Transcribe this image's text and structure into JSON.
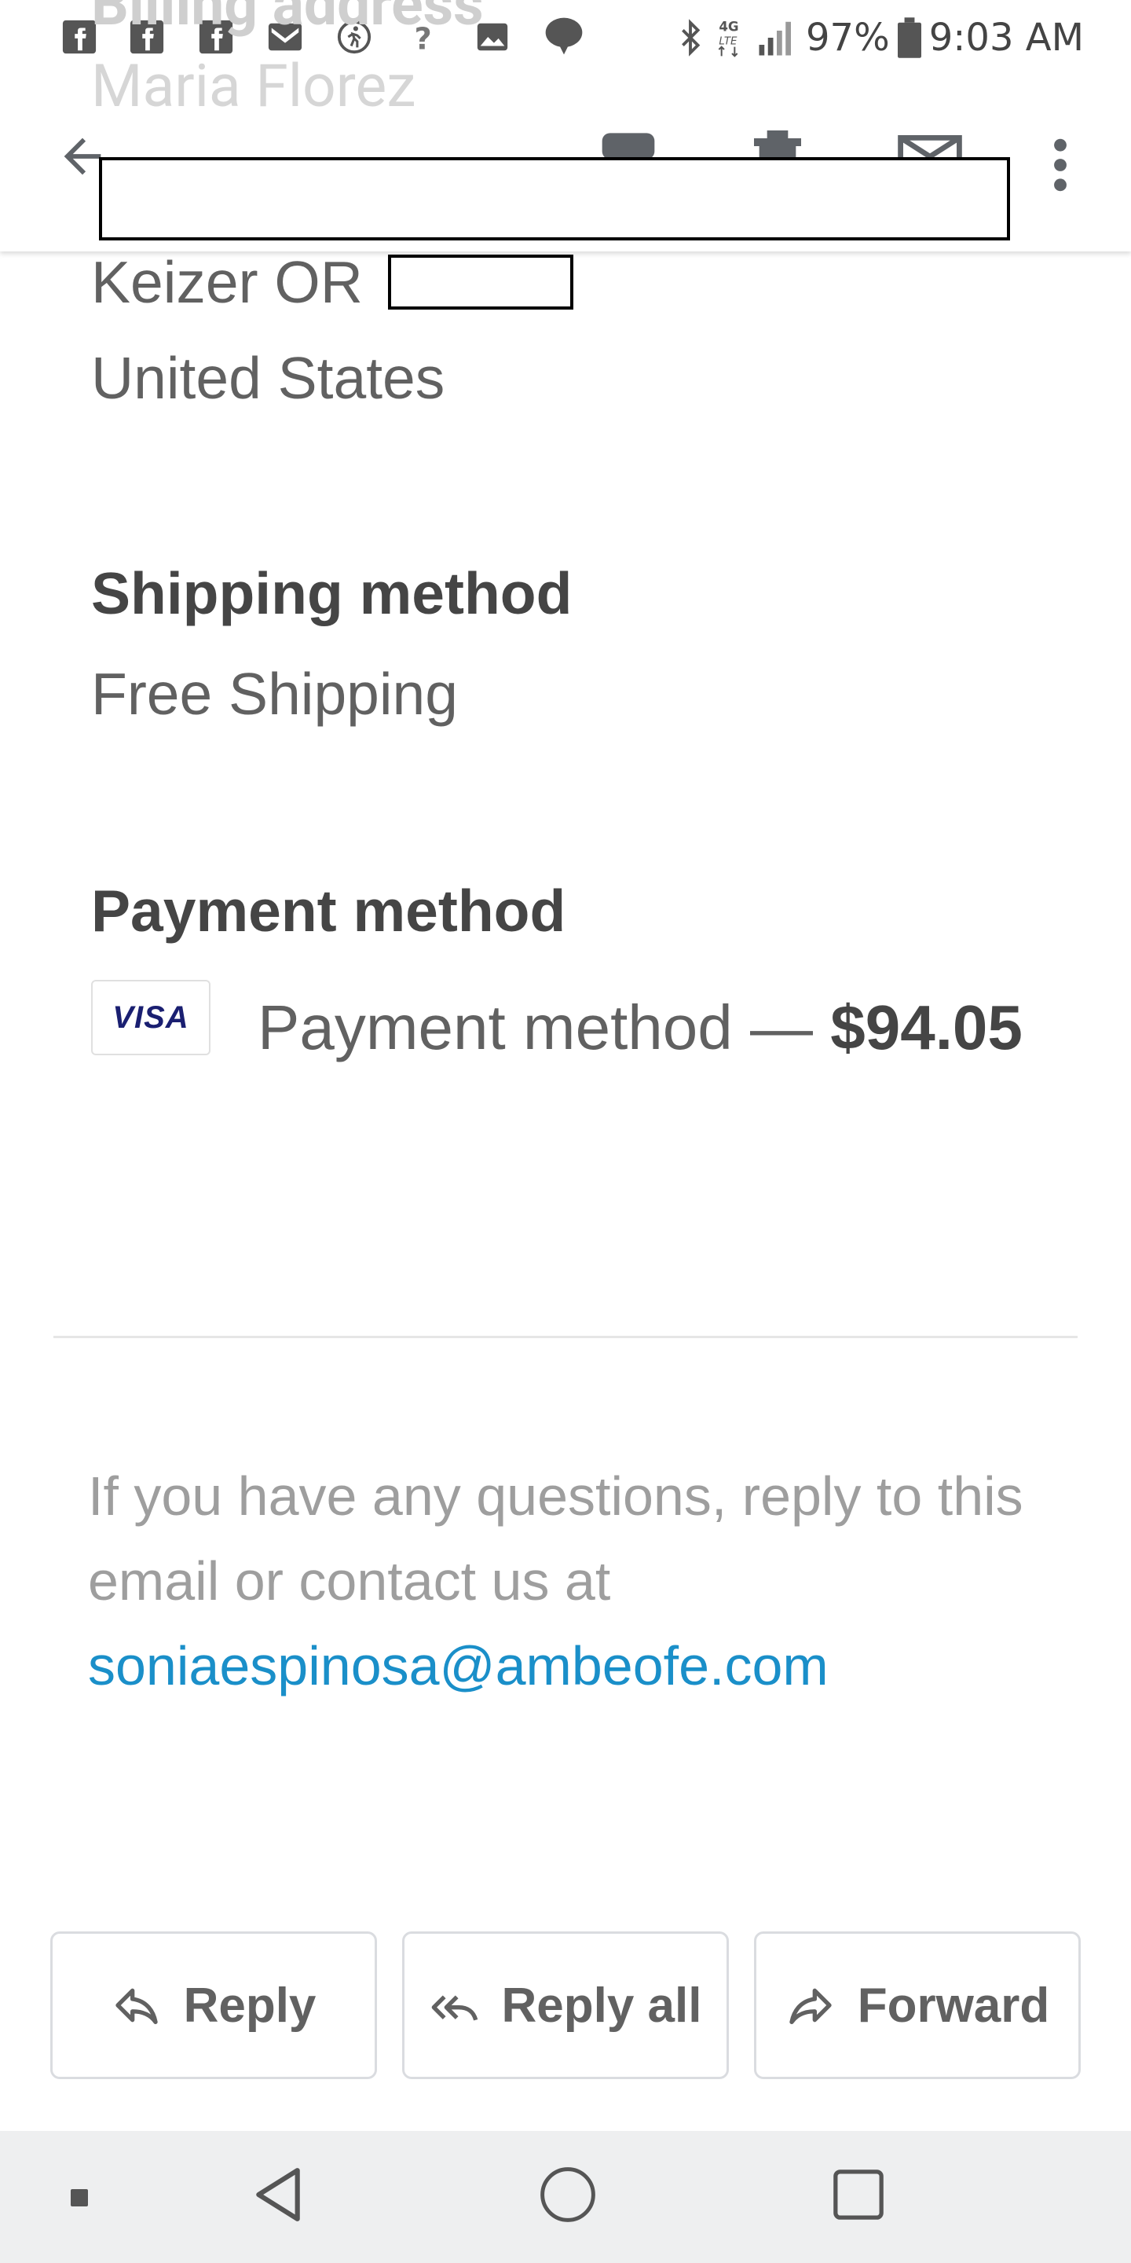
{
  "status_bar": {
    "icons": [
      "facebook-icon",
      "facebook-icon",
      "facebook-icon",
      "gmail-icon",
      "activity-icon",
      "question-icon",
      "image-icon",
      "notification-icon",
      "bluetooth-icon",
      "lte-icon",
      "signal-icon",
      "battery-icon"
    ],
    "network": "4G LTE",
    "battery": "97%",
    "time": "9:03 AM"
  },
  "scrolled_under": {
    "section_heading": "Billing address",
    "name": "Maria Florez"
  },
  "toolbar": {
    "back_icon": "arrow-back-icon",
    "archive_icon": "archive-icon",
    "delete_icon": "delete-icon",
    "mark_unread_icon": "mail-icon",
    "more_icon": "more-vert-icon"
  },
  "address": {
    "city_state": "Keizer OR",
    "country": "United States"
  },
  "shipping": {
    "heading": "Shipping method",
    "value": "Free Shipping"
  },
  "payment": {
    "heading": "Payment method",
    "card_brand": "VISA",
    "label": "Payment method — ",
    "amount": "$94.05"
  },
  "footer": {
    "text": "If you have any questions, reply to this email or contact us at",
    "email": "soniaespinosa@ambeofe.com"
  },
  "actions": {
    "reply": "Reply",
    "reply_all": "Reply all",
    "forward": "Forward"
  },
  "nav": {
    "back": "nav-back-icon",
    "home": "nav-home-icon",
    "recents": "nav-recents-icon"
  },
  "colors": {
    "link": "#1a8fc9",
    "visa": "#1a1f71",
    "nav_bg": "#eeeff0"
  }
}
